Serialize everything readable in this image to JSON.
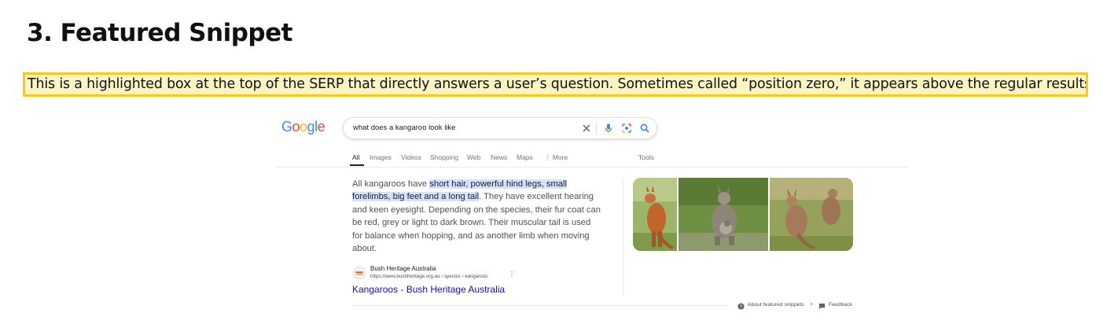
{
  "article": {
    "heading": "3. Featured Snippet",
    "highlight_text": "This is a highlighted box at the top of the SERP that directly answers a user’s question. Sometimes called “position zero,” it appears above the regular results."
  },
  "google": {
    "logo_letters": [
      {
        "ch": "G",
        "color": "#4285F4"
      },
      {
        "ch": "o",
        "color": "#EA4335"
      },
      {
        "ch": "o",
        "color": "#FBBC05"
      },
      {
        "ch": "g",
        "color": "#4285F4"
      },
      {
        "ch": "l",
        "color": "#34A853"
      },
      {
        "ch": "e",
        "color": "#EA4335"
      }
    ],
    "search_query": "what does a kangaroo look like",
    "icons": {
      "clear": "close-icon",
      "voice": "microphone-icon",
      "lens": "camera-lens-icon",
      "search": "search-icon"
    },
    "tabs": [
      "All",
      "Images",
      "Videos",
      "Shopping",
      "Web",
      "News",
      "Maps",
      "⋮ More"
    ],
    "active_tab": "All",
    "tools": "Tools"
  },
  "snippet": {
    "lines": [
      {
        "pre": "All kangaroos have ",
        "mark": "short hair, powerful hind legs, small",
        "post": ""
      },
      {
        "pre": "",
        "mark": "forelimbs, big feet and a long tail",
        "post": ". They have excellent hearing"
      },
      {
        "pre": "and keen eyesight. Depending on the species, their fur coat can",
        "mark": "",
        "post": ""
      },
      {
        "pre": "be red, grey or light to dark brown. Their muscular tail is used",
        "mark": "",
        "post": ""
      },
      {
        "pre": "for balance when hopping, and as another limb when moving",
        "mark": "",
        "post": ""
      },
      {
        "pre": "about.",
        "mark": "",
        "post": ""
      }
    ],
    "source_name": "Bush Heritage Australia",
    "source_url": "https://www.bushheritage.org.au › species › kangaroos",
    "source_menu": "⋮",
    "result_title": "Kangaroos - Bush Heritage Australia"
  },
  "images": [
    "kangaroo-red-photo",
    "kangaroo-with-joey-photo",
    "kangaroos-grass-photo"
  ],
  "footer": {
    "about": "About featured snippets",
    "separator": "•",
    "feedback": "Feedback"
  },
  "colors": {
    "highlight_bg": "#fdf4c4",
    "highlight_border": "#f8c81c",
    "link": "#1a0dab",
    "mark": "#d3e3fd"
  }
}
